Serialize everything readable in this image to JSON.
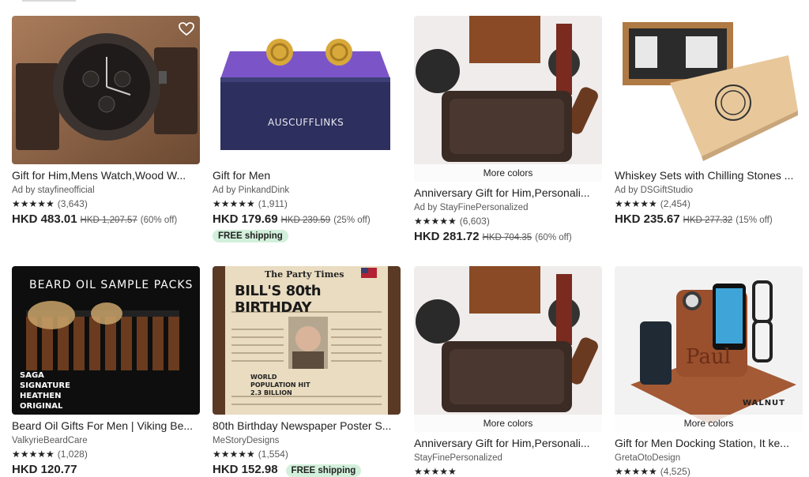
{
  "products": [
    {
      "title": "Gift for Him,Mens Watch,Wood W...",
      "shop": "Ad by stayfineofficial",
      "stars": "★★★★★",
      "reviews": "(3,643)",
      "price": "HKD 483.01",
      "orig": "HKD 1,207.57",
      "off": "(60% off)"
    },
    {
      "title": "Gift for Men",
      "shop": "Ad by PinkandDink",
      "stars": "★★★★★",
      "reviews": "(1,911)",
      "price": "HKD 179.69",
      "orig": "HKD 239.59",
      "off": "(25% off)",
      "shipping": "FREE shipping",
      "image_text": "AUSCUFFLINKS"
    },
    {
      "title": "Anniversary Gift for Him,Personali...",
      "shop": "Ad by StayFinePersonalized",
      "stars": "★★★★★",
      "reviews": "(6,603)",
      "price": "HKD 281.72",
      "orig": "HKD 704.35",
      "off": "(60% off)",
      "overlay": "More colors"
    },
    {
      "title": "Whiskey Sets with Chilling Stones ...",
      "shop": "Ad by DSGiftStudio",
      "stars": "★★★★★",
      "reviews": "(2,454)",
      "price": "HKD 235.67",
      "orig": "HKD 277.32",
      "off": "(15% off)"
    },
    {
      "title": "Beard Oil Gifts For Men | Viking Be...",
      "shop": "ValkyrieBeardCare",
      "stars": "★★★★★",
      "reviews": "(1,028)",
      "price": "HKD 120.77",
      "image_text": "BEARD OIL SAMPLE PACKS",
      "image_lines": [
        "SAGA",
        "SIGNATURE",
        "HEATHEN",
        "ORIGINAL"
      ]
    },
    {
      "title": "80th Birthday Newspaper Poster S...",
      "shop": "MeStoryDesigns",
      "stars": "★★★★★",
      "reviews": "(1,554)",
      "price": "HKD 152.98",
      "shipping": "FREE shipping",
      "image_text": "BILL'S 80th BIRTHDAY",
      "image_masthead": "The Party Times",
      "image_sub": "WORLD POPULATION HIT 2.3 BILLION"
    },
    {
      "title": "Anniversary Gift for Him,Personali...",
      "shop": "StayFinePersonalized",
      "stars": "★★★★★",
      "reviews": "",
      "price": "",
      "overlay": "More colors"
    },
    {
      "title": "Gift for Men Docking Station, It ke...",
      "shop": "GretaOtoDesign",
      "stars": "★★★★★",
      "reviews": "(4,525)",
      "price": "",
      "overlay": "More colors",
      "image_text": "WALNUT",
      "image_name": "Paul"
    }
  ]
}
